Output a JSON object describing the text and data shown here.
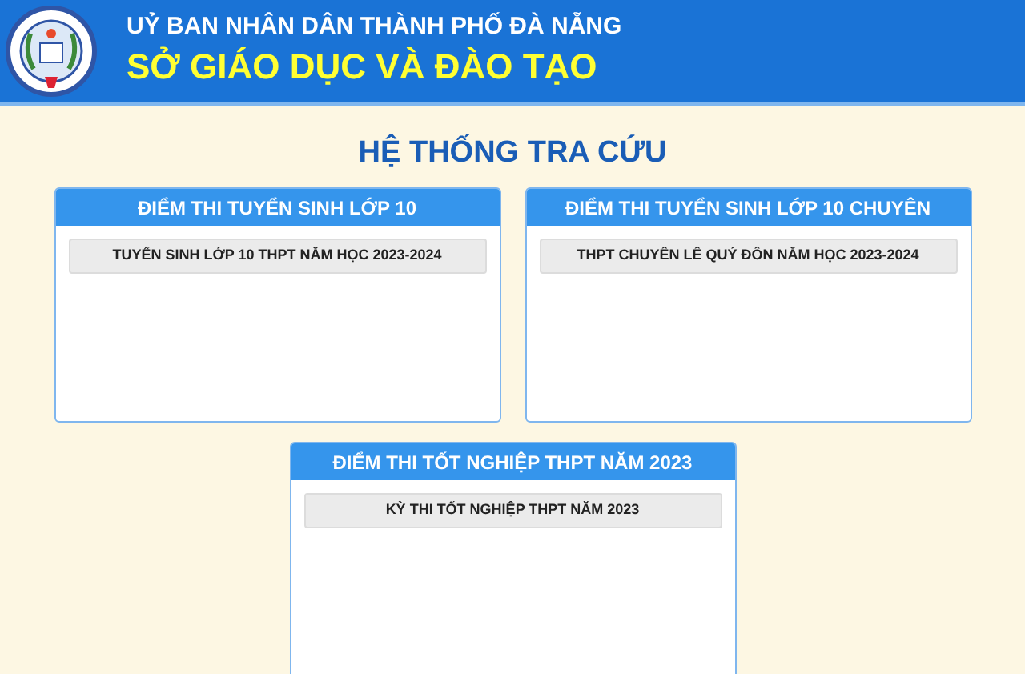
{
  "header": {
    "line_1": "UỶ BAN NHÂN DÂN THÀNH PHỐ ĐÀ NẴNG",
    "line_2": "SỞ GIÁO DỤC VÀ ĐÀO TẠO"
  },
  "title": "HỆ THỐNG TRA CỨU",
  "panels": [
    {
      "title": "ĐIỂM THI TUYỂN SINH LỚP 10",
      "links": [
        "TUYỂN SINH LỚP 10 THPT NĂM HỌC 2023-2024"
      ]
    },
    {
      "title": "ĐIỂM THI TUYỂN SINH LỚP 10 CHUYÊN",
      "links": [
        "THPT CHUYÊN LÊ QUÝ ĐÔN NĂM HỌC 2023-2024"
      ]
    },
    {
      "title": "ĐIỂM THI TỐT NGHIỆP THPT NĂM 2023",
      "links": [
        "KỲ THI TỐT NGHIỆP THPT NĂM 2023"
      ]
    }
  ]
}
